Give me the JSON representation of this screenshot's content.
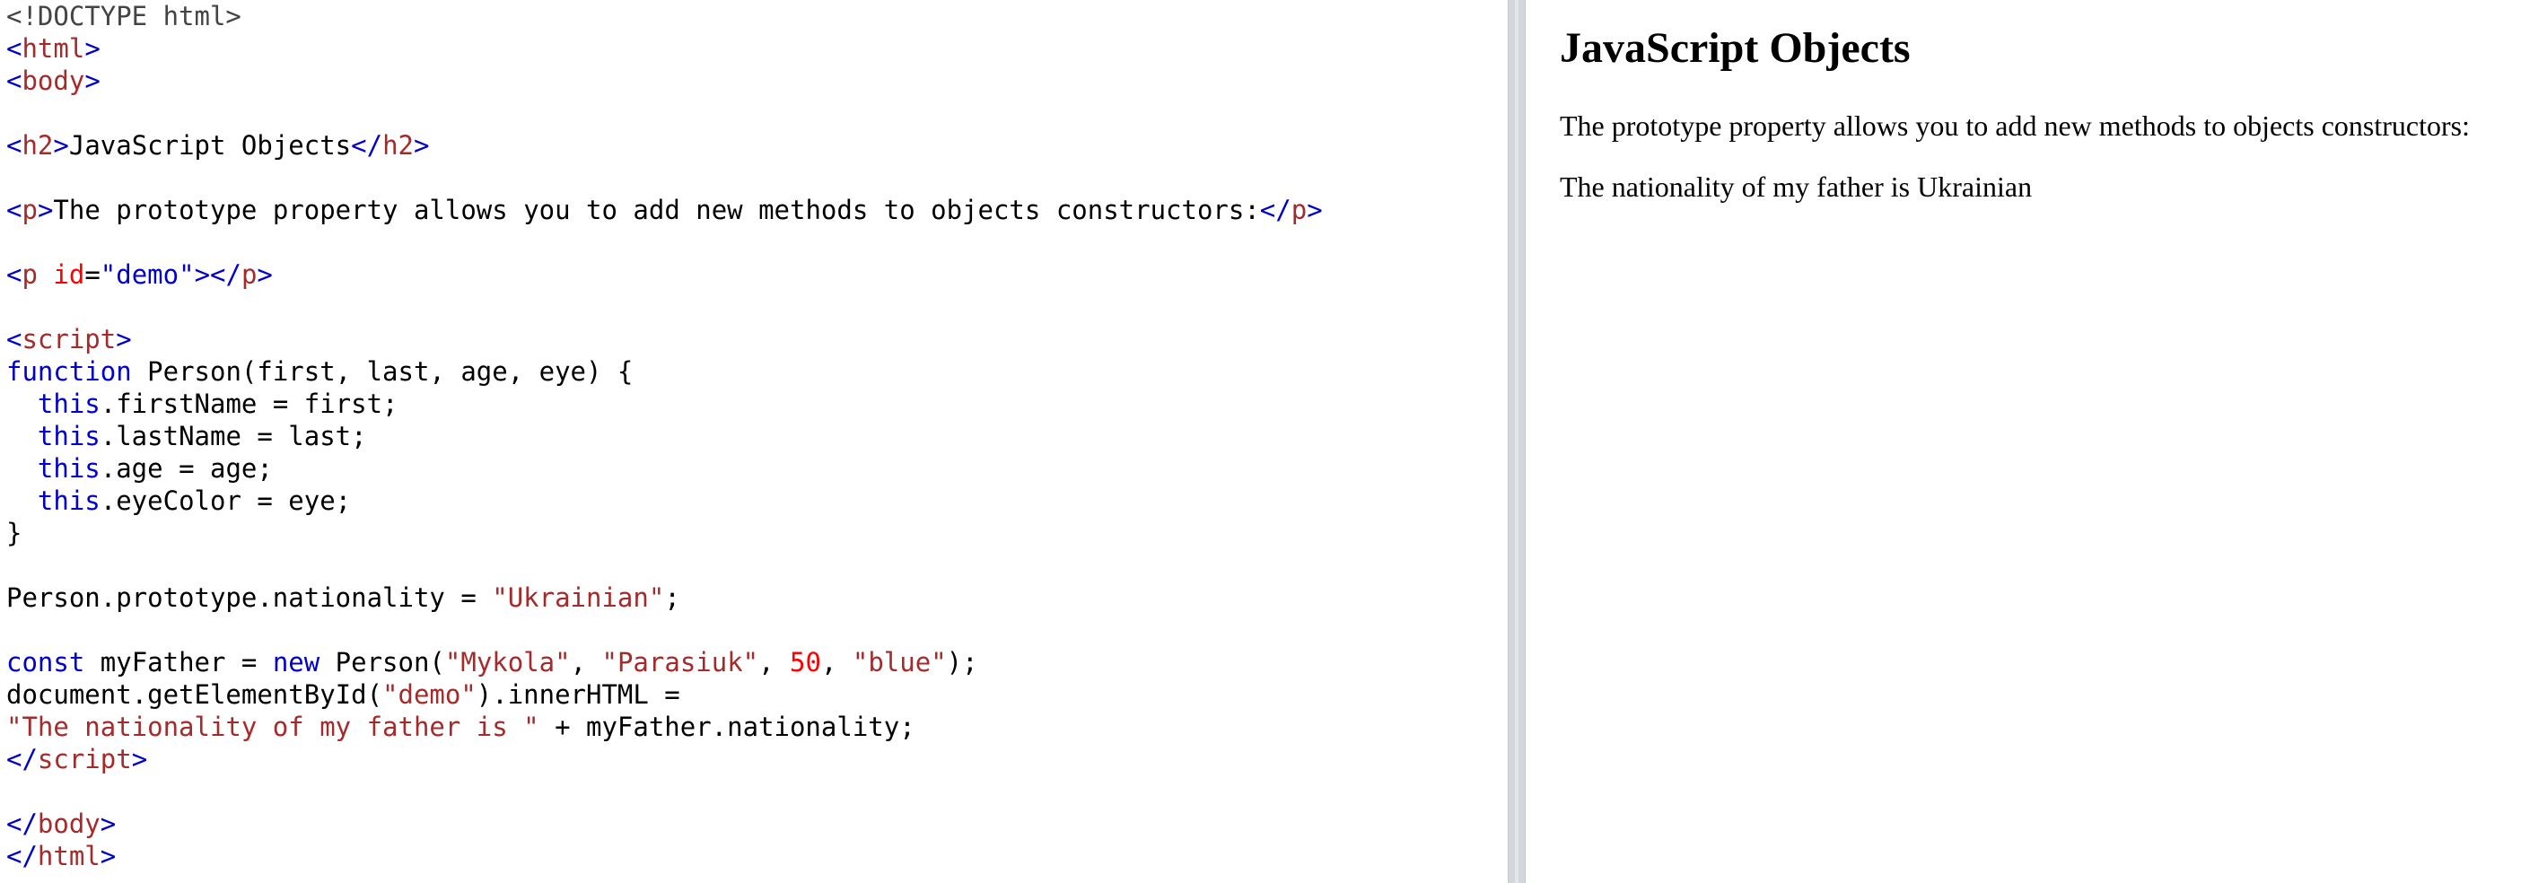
{
  "editor": {
    "lines": [
      [
        {
          "t": "<!DOCTYPE html>",
          "c": "doctype"
        }
      ],
      [
        {
          "t": "<",
          "c": "tag"
        },
        {
          "t": "html",
          "c": "tagname"
        },
        {
          "t": ">",
          "c": "tag"
        }
      ],
      [
        {
          "t": "<",
          "c": "tag"
        },
        {
          "t": "body",
          "c": "tagname"
        },
        {
          "t": ">",
          "c": "tag"
        }
      ],
      [],
      [
        {
          "t": "<",
          "c": "tag"
        },
        {
          "t": "h2",
          "c": "tagname"
        },
        {
          "t": ">",
          "c": "tag"
        },
        {
          "t": "JavaScript Objects",
          "c": ""
        },
        {
          "t": "</",
          "c": "tag"
        },
        {
          "t": "h2",
          "c": "tagname"
        },
        {
          "t": ">",
          "c": "tag"
        }
      ],
      [],
      [
        {
          "t": "<",
          "c": "tag"
        },
        {
          "t": "p",
          "c": "tagname"
        },
        {
          "t": ">",
          "c": "tag"
        },
        {
          "t": "The prototype property allows you to add new methods to objects constructors:",
          "c": ""
        },
        {
          "t": "</",
          "c": "tag"
        },
        {
          "t": "p",
          "c": "tagname"
        },
        {
          "t": ">",
          "c": "tag"
        }
      ],
      [],
      [
        {
          "t": "<",
          "c": "tag"
        },
        {
          "t": "p",
          "c": "tagname"
        },
        {
          "t": " ",
          "c": ""
        },
        {
          "t": "id",
          "c": "attr"
        },
        {
          "t": "=",
          "c": ""
        },
        {
          "t": "\"demo\"",
          "c": "tag"
        },
        {
          "t": "></",
          "c": "tag"
        },
        {
          "t": "p",
          "c": "tagname"
        },
        {
          "t": ">",
          "c": "tag"
        }
      ],
      [],
      [
        {
          "t": "<",
          "c": "tag"
        },
        {
          "t": "script",
          "c": "tagname"
        },
        {
          "t": ">",
          "c": "tag"
        }
      ],
      [
        {
          "t": "function",
          "c": "kw"
        },
        {
          "t": " Person(first, last, age, eye) {",
          "c": ""
        }
      ],
      [
        {
          "t": "  ",
          "c": ""
        },
        {
          "t": "this",
          "c": "kw"
        },
        {
          "t": ".firstName = first;",
          "c": ""
        }
      ],
      [
        {
          "t": "  ",
          "c": ""
        },
        {
          "t": "this",
          "c": "kw"
        },
        {
          "t": ".lastName = last;",
          "c": ""
        }
      ],
      [
        {
          "t": "  ",
          "c": ""
        },
        {
          "t": "this",
          "c": "kw"
        },
        {
          "t": ".age = age;",
          "c": ""
        }
      ],
      [
        {
          "t": "  ",
          "c": ""
        },
        {
          "t": "this",
          "c": "kw"
        },
        {
          "t": ".eyeColor = eye;",
          "c": ""
        }
      ],
      [
        {
          "t": "}",
          "c": ""
        }
      ],
      [],
      [
        {
          "t": "Person.prototype.nationality = ",
          "c": ""
        },
        {
          "t": "\"Ukrainian\"",
          "c": "str"
        },
        {
          "t": ";",
          "c": ""
        }
      ],
      [],
      [
        {
          "t": "const",
          "c": "kw"
        },
        {
          "t": " myFather = ",
          "c": ""
        },
        {
          "t": "new",
          "c": "kw"
        },
        {
          "t": " Person(",
          "c": ""
        },
        {
          "t": "\"Mykola\"",
          "c": "str"
        },
        {
          "t": ", ",
          "c": ""
        },
        {
          "t": "\"Parasiuk\"",
          "c": "str"
        },
        {
          "t": ", ",
          "c": ""
        },
        {
          "t": "50",
          "c": "num"
        },
        {
          "t": ", ",
          "c": ""
        },
        {
          "t": "\"blue\"",
          "c": "str"
        },
        {
          "t": ");",
          "c": ""
        }
      ],
      [
        {
          "t": "document.getElementById(",
          "c": ""
        },
        {
          "t": "\"demo\"",
          "c": "str"
        },
        {
          "t": ").innerHTML =",
          "c": ""
        }
      ],
      [
        {
          "t": "\"The nationality of my father is \"",
          "c": "str"
        },
        {
          "t": " + myFather.nationality;",
          "c": ""
        }
      ],
      [
        {
          "t": "</",
          "c": "tag"
        },
        {
          "t": "script",
          "c": "tagname"
        },
        {
          "t": ">",
          "c": "tag"
        }
      ],
      [],
      [
        {
          "t": "</",
          "c": "tag"
        },
        {
          "t": "body",
          "c": "tagname"
        },
        {
          "t": ">",
          "c": "tag"
        }
      ],
      [
        {
          "t": "</",
          "c": "tag"
        },
        {
          "t": "html",
          "c": "tagname"
        },
        {
          "t": ">",
          "c": "tag"
        }
      ]
    ]
  },
  "result": {
    "heading": "JavaScript Objects",
    "paragraph": "The prototype property allows you to add new methods to objects constructors:",
    "demo_output": "The nationality of my father is Ukrainian"
  },
  "colors": {
    "tag": "#0000cd",
    "tagname": "#a52a2a",
    "attr": "#ff0000",
    "string": "#a52a2a",
    "keyword": "#0000cd",
    "number": "#ff0000",
    "splitter": "#d3d6da"
  }
}
